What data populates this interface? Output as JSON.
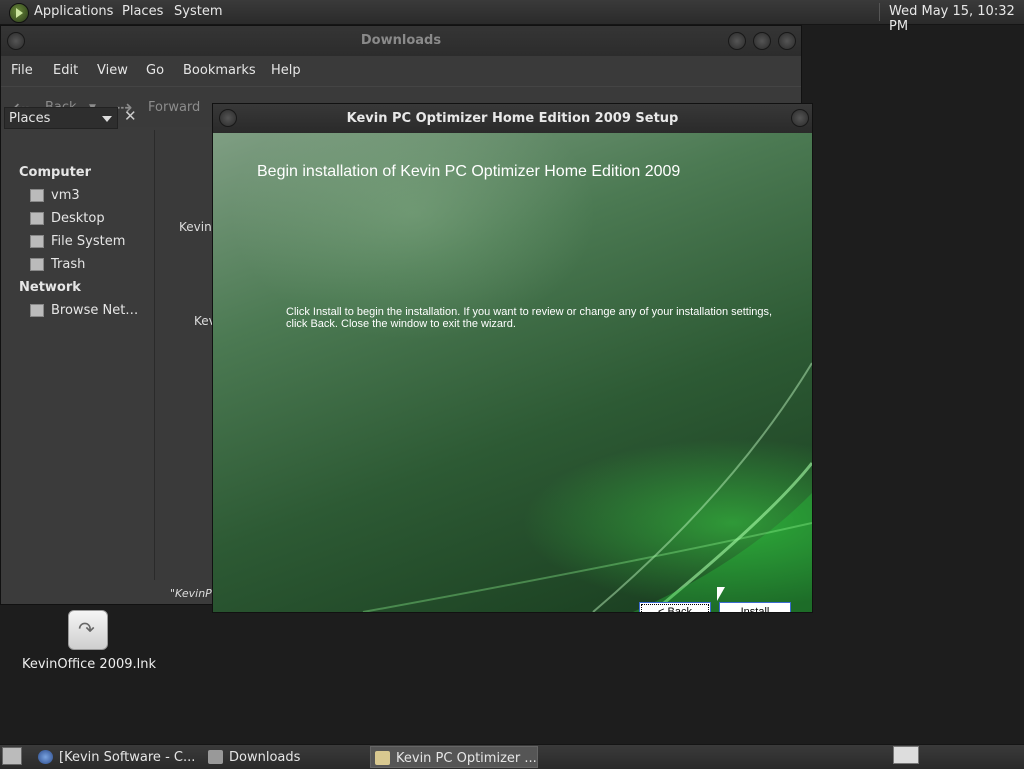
{
  "top_panel": {
    "menus": [
      "Applications",
      "Places",
      "System"
    ],
    "clock": "Wed May 15, 10:32 PM"
  },
  "file_manager": {
    "title": "Downloads",
    "menu": [
      "File",
      "Edit",
      "View",
      "Go",
      "Bookmarks",
      "Help"
    ],
    "toolbar": {
      "back": "Back",
      "forward": "Forward"
    },
    "sidebar": {
      "selector": "Places",
      "sections": [
        {
          "heading": "Computer",
          "items": [
            "vm3",
            "Desktop",
            "File System",
            "Trash"
          ]
        },
        {
          "heading": "Network",
          "items": [
            "Browse Net…"
          ]
        }
      ]
    },
    "content_fragments": [
      "Kevin",
      "Kev",
      "\"KevinP"
    ]
  },
  "desktop": {
    "icon_label": "KevinOffice 2009.lnk"
  },
  "installer": {
    "title": "Kevin PC Optimizer Home Edition 2009 Setup",
    "heading": "Begin installation of Kevin PC Optimizer Home Edition 2009",
    "body_line1": "Click Install to begin the installation.  If you want to review or change any of your installation settings,",
    "body_line2": "click Back.  Close the window to exit the wizard.",
    "back_label": "< Back",
    "install_label": "Install"
  },
  "taskbar": {
    "tasks": [
      "[Kevin Software - C...",
      "Downloads",
      "Kevin PC Optimizer ..."
    ]
  }
}
